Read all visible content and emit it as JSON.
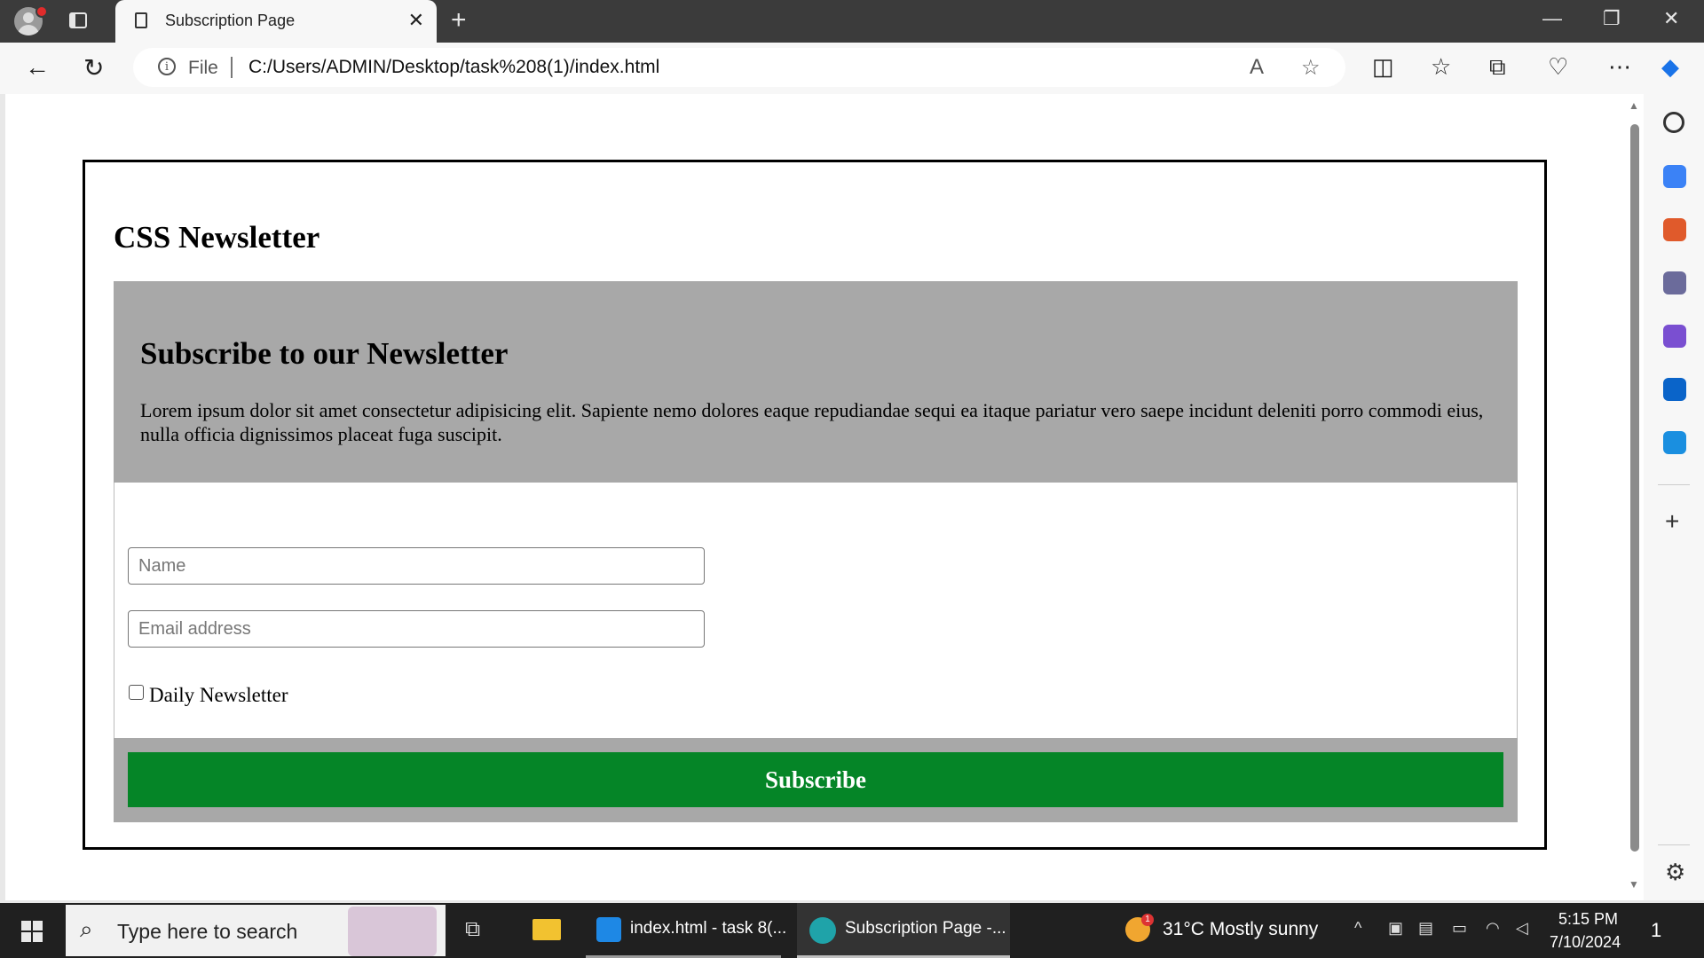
{
  "browser": {
    "tab_title": "Subscription Page",
    "tab_close": "✕",
    "new_tab": "+",
    "window_controls": {
      "minimize": "—",
      "restore": "❐",
      "close": "✕"
    },
    "address": {
      "scheme_label": "File",
      "url": "C:/Users/ADMIN/Desktop/task%208(1)/index.html"
    }
  },
  "page": {
    "title": "CSS Newsletter",
    "subscribe_heading": "Subscribe to our Newsletter",
    "description": "Lorem ipsum dolor sit amet consectetur adipisicing elit. Sapiente nemo dolores eaque repudiandae sequi ea itaque pariatur vero saepe incidunt deleniti porro commodi eius, nulla officia dignissimos placeat fuga suscipit.",
    "form": {
      "name_placeholder": "Name",
      "email_placeholder": "Email address",
      "checkbox_label": "Daily Newsletter",
      "checkbox_checked": false,
      "submit_label": "Subscribe"
    },
    "colors": {
      "panel_grey": "#a8a8a8",
      "button_green": "#058527"
    }
  },
  "taskbar": {
    "search_placeholder": "Type here to search",
    "apps": [
      {
        "label": "index.html - task 8(..."
      },
      {
        "label": "Subscription Page -..."
      }
    ],
    "weather": {
      "badge": "1",
      "text": "31°C  Mostly sunny"
    },
    "clock": {
      "time": "5:15 PM",
      "date": "7/10/2024"
    },
    "notifications": "1"
  }
}
